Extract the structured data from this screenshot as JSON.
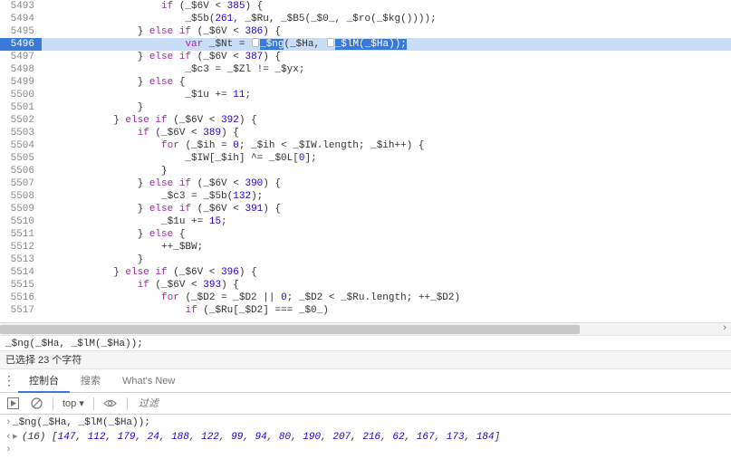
{
  "code": {
    "lines": [
      {
        "n": 5493,
        "indent": 20,
        "tokens": [
          [
            "k",
            "if"
          ],
          [
            "p",
            " (_$6V < "
          ],
          [
            "n",
            "385"
          ],
          [
            "p",
            ") {"
          ]
        ]
      },
      {
        "n": 5494,
        "indent": 24,
        "tokens": [
          [
            "id",
            "_$5b("
          ],
          [
            "n",
            "261"
          ],
          [
            "p",
            ", _$Ru, _$B5(_$0_, _$ro(_$kg())));"
          ]
        ]
      },
      {
        "n": 5495,
        "indent": 16,
        "tokens": [
          [
            "p",
            "} "
          ],
          [
            "k",
            "else if"
          ],
          [
            "p",
            " (_$6V < "
          ],
          [
            "n",
            "386"
          ],
          [
            "p",
            ") {"
          ]
        ]
      },
      {
        "n": 5496,
        "indent": 24,
        "current": true,
        "tokens": [
          [
            "v",
            "var"
          ],
          [
            "p",
            " _$Nt = "
          ],
          [
            "md",
            ""
          ],
          [
            "sel",
            "_$ng"
          ],
          [
            "p",
            "(_$Ha, "
          ],
          [
            "md",
            ""
          ],
          [
            "sel",
            "_$lM(_$Ha));"
          ]
        ]
      },
      {
        "n": 5497,
        "indent": 16,
        "tokens": [
          [
            "p",
            "} "
          ],
          [
            "k",
            "else if"
          ],
          [
            "p",
            " (_$6V < "
          ],
          [
            "n",
            "387"
          ],
          [
            "p",
            ") {"
          ]
        ]
      },
      {
        "n": 5498,
        "indent": 24,
        "tokens": [
          [
            "id",
            "_$c3 = _$Zl != _$yx;"
          ]
        ]
      },
      {
        "n": 5499,
        "indent": 16,
        "tokens": [
          [
            "p",
            "} "
          ],
          [
            "k",
            "else"
          ],
          [
            "p",
            " {"
          ]
        ]
      },
      {
        "n": 5500,
        "indent": 24,
        "tokens": [
          [
            "id",
            "_$1u += "
          ],
          [
            "n",
            "11"
          ],
          [
            "p",
            ";"
          ]
        ]
      },
      {
        "n": 5501,
        "indent": 16,
        "tokens": [
          [
            "p",
            "}"
          ]
        ]
      },
      {
        "n": 5502,
        "indent": 12,
        "tokens": [
          [
            "p",
            "} "
          ],
          [
            "k",
            "else if"
          ],
          [
            "p",
            " (_$6V < "
          ],
          [
            "n",
            "392"
          ],
          [
            "p",
            ") {"
          ]
        ]
      },
      {
        "n": 5503,
        "indent": 16,
        "tokens": [
          [
            "k",
            "if"
          ],
          [
            "p",
            " (_$6V < "
          ],
          [
            "n",
            "389"
          ],
          [
            "p",
            ") {"
          ]
        ]
      },
      {
        "n": 5504,
        "indent": 20,
        "tokens": [
          [
            "k",
            "for"
          ],
          [
            "p",
            " (_$ih = "
          ],
          [
            "n",
            "0"
          ],
          [
            "p",
            "; _$ih < _$IW.length; _$ih++) {"
          ]
        ]
      },
      {
        "n": 5505,
        "indent": 24,
        "tokens": [
          [
            "id",
            "_$IW[_$ih] ^= _$0L["
          ],
          [
            "n",
            "0"
          ],
          [
            "p",
            "];"
          ]
        ]
      },
      {
        "n": 5506,
        "indent": 20,
        "tokens": [
          [
            "p",
            "}"
          ]
        ]
      },
      {
        "n": 5507,
        "indent": 16,
        "tokens": [
          [
            "p",
            "} "
          ],
          [
            "k",
            "else if"
          ],
          [
            "p",
            " (_$6V < "
          ],
          [
            "n",
            "390"
          ],
          [
            "p",
            ") {"
          ]
        ]
      },
      {
        "n": 5508,
        "indent": 20,
        "tokens": [
          [
            "id",
            "_$c3 = _$5b("
          ],
          [
            "n",
            "132"
          ],
          [
            "p",
            ");"
          ]
        ]
      },
      {
        "n": 5509,
        "indent": 16,
        "tokens": [
          [
            "p",
            "} "
          ],
          [
            "k",
            "else if"
          ],
          [
            "p",
            " (_$6V < "
          ],
          [
            "n",
            "391"
          ],
          [
            "p",
            ") {"
          ]
        ]
      },
      {
        "n": 5510,
        "indent": 20,
        "tokens": [
          [
            "id",
            "_$1u += "
          ],
          [
            "n",
            "15"
          ],
          [
            "p",
            ";"
          ]
        ]
      },
      {
        "n": 5511,
        "indent": 16,
        "tokens": [
          [
            "p",
            "} "
          ],
          [
            "k",
            "else"
          ],
          [
            "p",
            " {"
          ]
        ]
      },
      {
        "n": 5512,
        "indent": 20,
        "tokens": [
          [
            "id",
            "++_$BW;"
          ]
        ]
      },
      {
        "n": 5513,
        "indent": 16,
        "tokens": [
          [
            "p",
            "}"
          ]
        ]
      },
      {
        "n": 5514,
        "indent": 12,
        "tokens": [
          [
            "p",
            "} "
          ],
          [
            "k",
            "else if"
          ],
          [
            "p",
            " (_$6V < "
          ],
          [
            "n",
            "396"
          ],
          [
            "p",
            ") {"
          ]
        ]
      },
      {
        "n": 5515,
        "indent": 16,
        "tokens": [
          [
            "k",
            "if"
          ],
          [
            "p",
            " (_$6V < "
          ],
          [
            "n",
            "393"
          ],
          [
            "p",
            ") {"
          ]
        ]
      },
      {
        "n": 5516,
        "indent": 20,
        "tokens": [
          [
            "k",
            "for"
          ],
          [
            "p",
            " (_$D2 = _$D2 || "
          ],
          [
            "n",
            "0"
          ],
          [
            "p",
            "; _$D2 < _$Ru.length; ++_$D2)"
          ]
        ]
      },
      {
        "n": 5517,
        "indent": 24,
        "tokens": [
          [
            "k",
            "if"
          ],
          [
            "p",
            " (_$Ru[_$D2] === _$0_)"
          ]
        ]
      }
    ]
  },
  "breadcrumb": "_$ng(_$Ha, _$lM(_$Ha));",
  "status": "已选择 23 个字符",
  "tabs": {
    "console": "控制台",
    "search": "搜索",
    "whatsnew": "What's New"
  },
  "toolbar": {
    "ctx": "top",
    "ctxChevron": "▾",
    "filter_placeholder": "过滤"
  },
  "console": {
    "input": "_$ng(_$Ha, _$lM(_$Ha));",
    "result_prefix": "(16)",
    "result_values": [
      147,
      112,
      179,
      24,
      188,
      122,
      99,
      94,
      80,
      190,
      207,
      216,
      62,
      167,
      173,
      184
    ]
  }
}
